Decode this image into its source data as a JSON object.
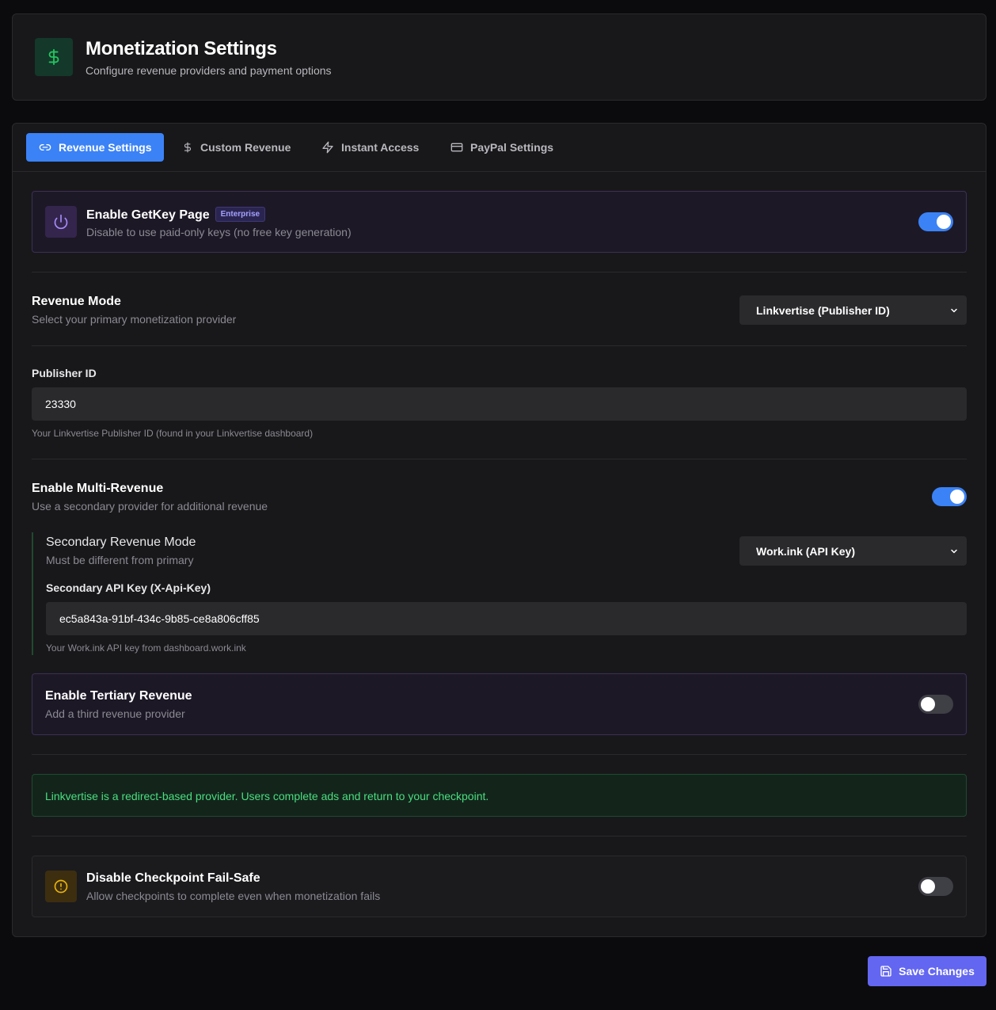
{
  "header": {
    "title": "Monetization Settings",
    "subtitle": "Configure revenue providers and payment options",
    "icon": "dollar-icon",
    "accent_color": "#22c55e"
  },
  "tabs": [
    {
      "label": "Revenue Settings",
      "icon": "link-icon",
      "active": true
    },
    {
      "label": "Custom Revenue",
      "icon": "dollar-icon",
      "active": false
    },
    {
      "label": "Instant Access",
      "icon": "lightning-icon",
      "active": false
    },
    {
      "label": "PayPal Settings",
      "icon": "credit-card-icon",
      "active": false
    }
  ],
  "getkey": {
    "title": "Enable GetKey Page",
    "badge": "Enterprise",
    "description": "Disable to use paid-only keys (no free key generation)",
    "enabled": true,
    "icon": "power-icon"
  },
  "revenue_mode": {
    "title": "Revenue Mode",
    "description": "Select your primary monetization provider",
    "selected": "Linkvertise (Publisher ID)"
  },
  "publisher": {
    "label": "Publisher ID",
    "value": "23330",
    "help": "Your Linkvertise Publisher ID (found in your Linkvertise dashboard)"
  },
  "multi_revenue": {
    "title": "Enable Multi-Revenue",
    "description": "Use a secondary provider for additional revenue",
    "enabled": true,
    "secondary": {
      "title": "Secondary Revenue Mode",
      "description": "Must be different from primary",
      "selected": "Work.ink (API Key)",
      "api_label": "Secondary API Key (X-Api-Key)",
      "api_value": "ec5a843a-91bf-434c-9b85-ce8a806cff85",
      "api_help": "Your Work.ink API key from dashboard.work.ink"
    }
  },
  "tertiary": {
    "title": "Enable Tertiary Revenue",
    "description": "Add a third revenue provider",
    "enabled": false
  },
  "info_notice": "Linkvertise is a redirect-based provider. Users complete ads and return to your checkpoint.",
  "failsafe": {
    "title": "Disable Checkpoint Fail-Safe",
    "description": "Allow checkpoints to complete even when monetization fails",
    "enabled": false,
    "icon": "alert-circle-icon"
  },
  "save_button": {
    "label": "Save Changes",
    "icon": "save-icon",
    "color": "#6366f1"
  }
}
